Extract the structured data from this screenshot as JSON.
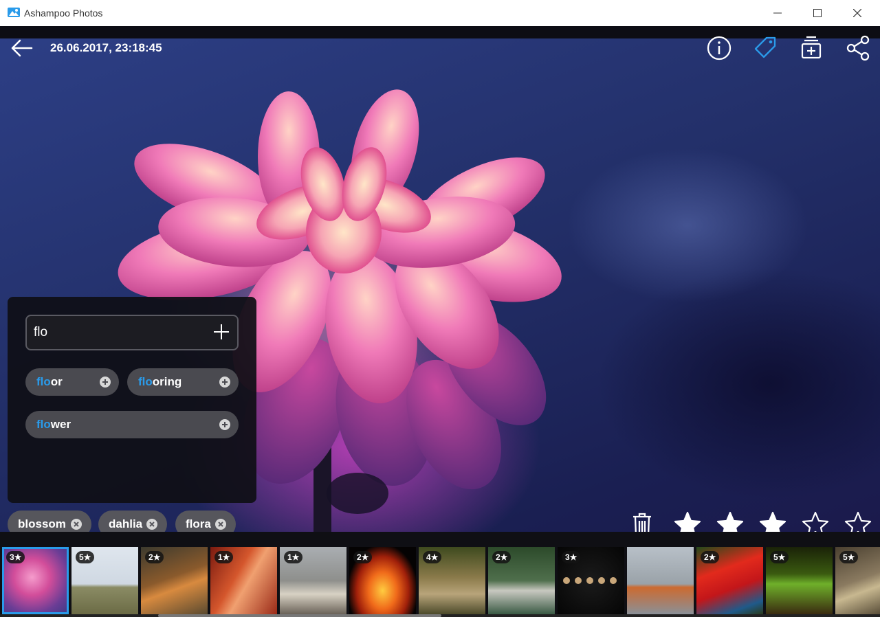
{
  "window": {
    "title": "Ashampoo Photos",
    "controls": [
      "minimize",
      "maximize",
      "close"
    ]
  },
  "viewer": {
    "date": "26.06.2017, 23:18:45",
    "toolbar_icons": [
      "info-icon",
      "tag-icon",
      "add-to-album-icon",
      "share-icon"
    ]
  },
  "tag_panel": {
    "input_value": "flo",
    "suggestions": [
      {
        "match": "flo",
        "rest": "or"
      },
      {
        "match": "flo",
        "rest": "oring"
      },
      {
        "match": "flo",
        "rest": "wer"
      }
    ]
  },
  "tags": [
    "blossom",
    "dahlia",
    "flora"
  ],
  "rating": {
    "value": 3,
    "max": 5
  },
  "filmstrip": [
    {
      "rating": "3★",
      "subject": "pink dahlia"
    },
    {
      "rating": "5★",
      "subject": "girl with balloons"
    },
    {
      "rating": "2★",
      "subject": "fox lying"
    },
    {
      "rating": "1★",
      "subject": "red canyon"
    },
    {
      "rating": "1★",
      "subject": "ducks"
    },
    {
      "rating": "2★",
      "subject": "fire"
    },
    {
      "rating": "4★",
      "subject": "hedgehog"
    },
    {
      "rating": "2★",
      "subject": "ducklings"
    },
    {
      "rating": "3★",
      "subject": "moon phases"
    },
    {
      "rating": "",
      "subject": "fox standing"
    },
    {
      "rating": "2★",
      "subject": "parrot"
    },
    {
      "rating": "5★",
      "subject": "tree frog"
    },
    {
      "rating": "5★",
      "subject": "cat"
    }
  ],
  "colors": {
    "accent": "#2a9bea",
    "panel": "#0f0f16",
    "chip": "#56565c"
  }
}
